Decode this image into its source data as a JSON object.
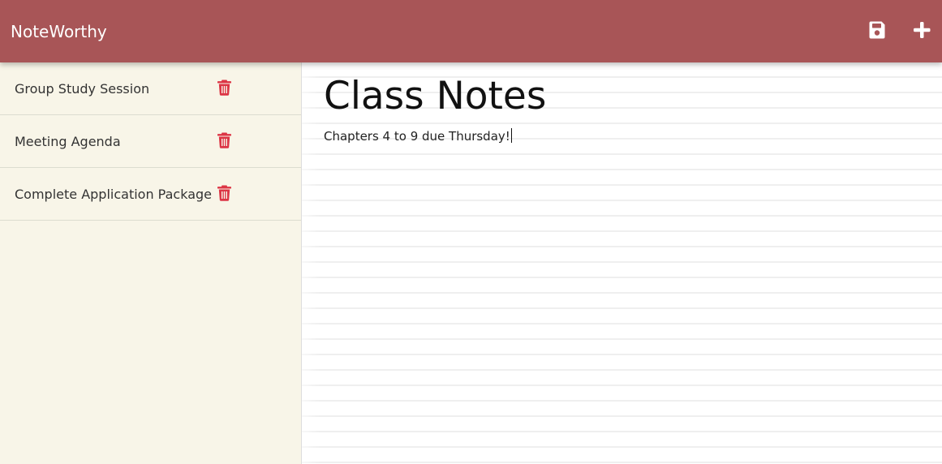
{
  "app": {
    "brand": "NoteWorthy",
    "colors": {
      "header": "#a85557",
      "sidebar": "#f8f5e8",
      "trash": "#dc3545",
      "icon": "#ffffff"
    }
  },
  "toolbar": {
    "save_icon": "floppy-disk-icon",
    "add_icon": "plus-icon"
  },
  "sidebar": {
    "items": [
      {
        "label": "Group Study Session",
        "icon": "trash-icon"
      },
      {
        "label": "Meeting Agenda",
        "icon": "trash-icon"
      },
      {
        "label": "Complete Application Package",
        "icon": "trash-icon"
      }
    ]
  },
  "editor": {
    "title": "Class Notes",
    "body": "Chapters 4 to 9 due Thursday!"
  }
}
